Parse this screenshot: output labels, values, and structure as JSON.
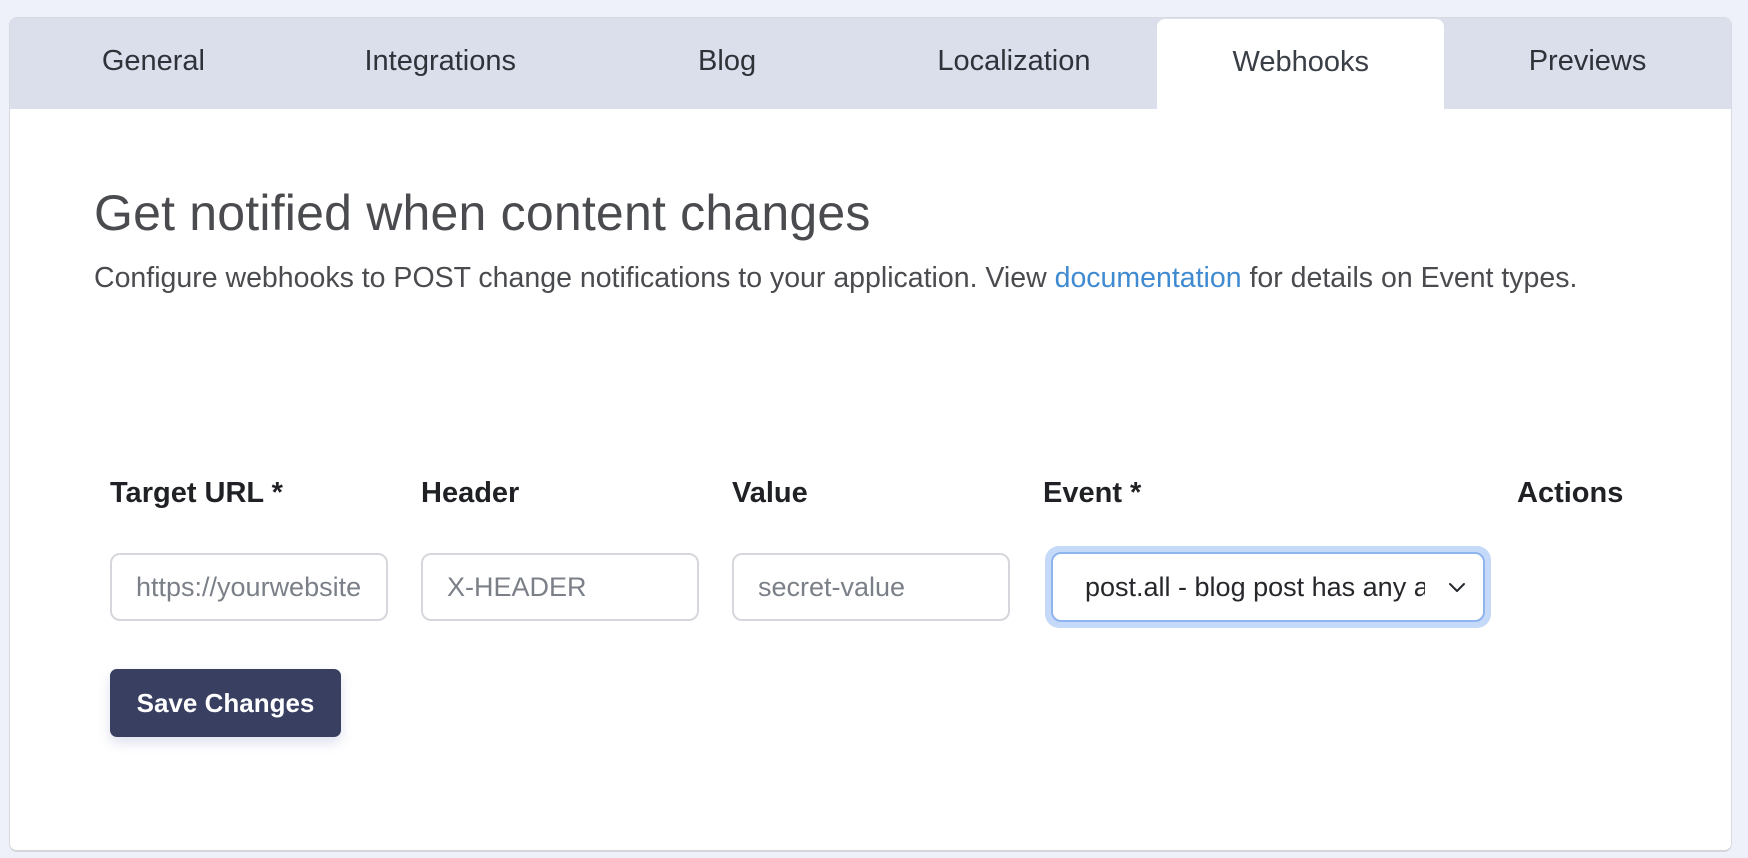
{
  "tabs": [
    {
      "label": "General",
      "active": false
    },
    {
      "label": "Integrations",
      "active": false
    },
    {
      "label": "Blog",
      "active": false
    },
    {
      "label": "Localization",
      "active": false
    },
    {
      "label": "Webhooks",
      "active": true
    },
    {
      "label": "Previews",
      "active": false
    }
  ],
  "page": {
    "title": "Get notified when content changes",
    "description_before": "Configure webhooks to POST change notifications to your application. View ",
    "documentation_link": "documentation",
    "description_after": " for details on Event types."
  },
  "form": {
    "columns": {
      "target_url": "Target URL *",
      "header": "Header",
      "value": "Value",
      "event": "Event *",
      "actions": "Actions"
    },
    "target_url_placeholder": "https://yourwebsite.com/webhook",
    "header_placeholder": "X-HEADER",
    "value_placeholder": "secret-value",
    "event_selected": "post.all - blog post has any action",
    "save_label": "Save Changes"
  },
  "colors": {
    "tab_bar": "#dbdfec",
    "link": "#3f8ad0",
    "primary_button": "#383f60",
    "focus_ring": "#c5d9f9"
  }
}
